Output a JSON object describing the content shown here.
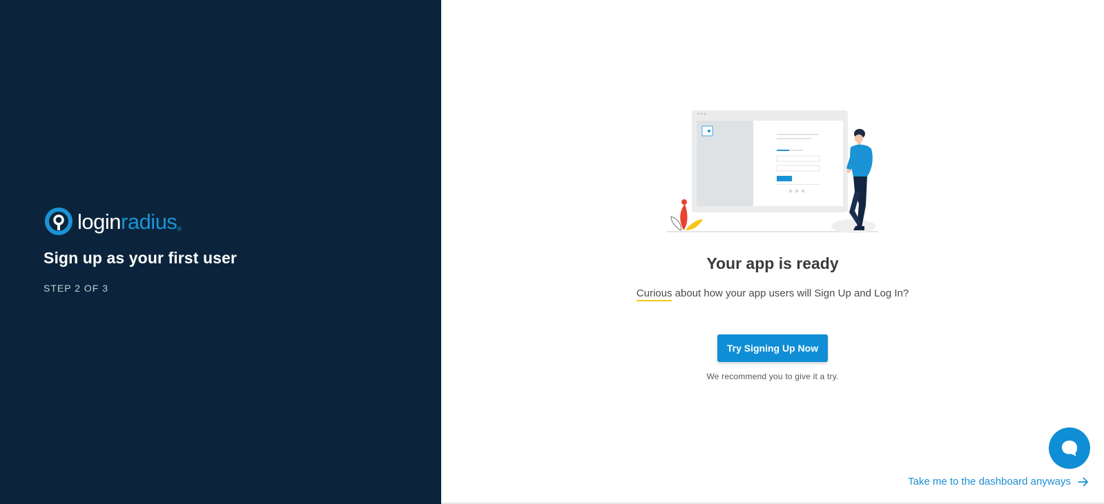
{
  "brand": {
    "logo_text_a": "login",
    "logo_text_b": "radius",
    "logo_tm": "®",
    "accent": "#1b93d6",
    "panel_bg": "#0b243b"
  },
  "left": {
    "title": "Sign up as your first user",
    "step": "STEP 2 OF 3"
  },
  "main": {
    "title": "Your app is ready",
    "subtitle_highlight": "Curious",
    "subtitle_rest": " about how your app users will Sign Up and Log In?",
    "cta_label": "Try Signing Up Now",
    "cta_note": "We recommend you to give it a try.",
    "dashboard_link": "Take me to the dashboard anyways"
  },
  "icons": {
    "chat": "chat-bubble-icon",
    "arrow": "arrow-right-icon",
    "logo": "loginradius-logo-icon"
  }
}
